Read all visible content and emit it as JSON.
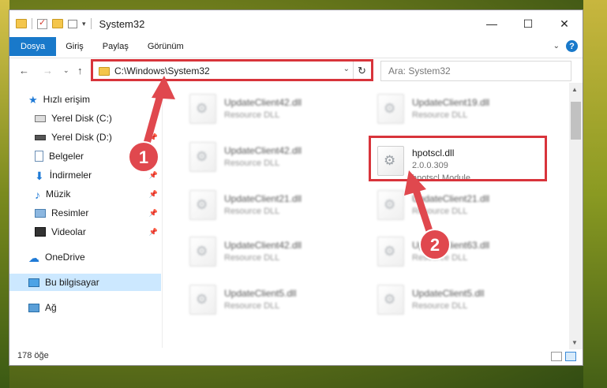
{
  "window": {
    "title": "System32"
  },
  "ribbon": {
    "tabs": [
      "Dosya",
      "Giriş",
      "Paylaş",
      "Görünüm"
    ]
  },
  "address": {
    "path": "C:\\Windows\\System32",
    "search_placeholder": "Ara: System32"
  },
  "sidebar": {
    "items": [
      {
        "label": "Hızlı erişim",
        "pinned": false
      },
      {
        "label": "Yerel Disk (C:)",
        "pinned": true
      },
      {
        "label": "Yerel Disk (D:)",
        "pinned": true
      },
      {
        "label": "Belgeler",
        "pinned": true
      },
      {
        "label": "İndirmeler",
        "pinned": true
      },
      {
        "label": "Müzik",
        "pinned": true
      },
      {
        "label": "Resimler",
        "pinned": true
      },
      {
        "label": "Videolar",
        "pinned": true
      },
      {
        "label": "OneDrive",
        "pinned": false
      },
      {
        "label": "Bu bilgisayar",
        "pinned": false,
        "selected": true
      },
      {
        "label": "Ağ",
        "pinned": false
      }
    ]
  },
  "files": {
    "left": [
      {
        "name": "UpdateClient42.dll",
        "type": "Resource DLL"
      },
      {
        "name": "UpdateClient42.dll",
        "type": "Resource DLL"
      },
      {
        "name": "UpdateClient21.dll",
        "type": "Resource DLL"
      },
      {
        "name": "UpdateClient42.dll",
        "type": "Resource DLL"
      },
      {
        "name": "UpdateClient5.dll",
        "type": "Resource DLL"
      }
    ],
    "right": [
      {
        "name": "UpdateClient19.dll",
        "type": "Resource DLL"
      },
      {
        "name": "hpotscl.dll",
        "version": "2.0.0.309",
        "type": "hpotscl Module"
      },
      {
        "name": "UpdateClient21.dll",
        "type": "Resource DLL"
      },
      {
        "name": "UpdateClient63.dll",
        "type": "Resource DLL"
      },
      {
        "name": "UpdateClient5.dll",
        "type": "Resource DLL"
      }
    ]
  },
  "status": {
    "count": "178 öğe"
  },
  "annotations": {
    "step1": "1",
    "step2": "2",
    "color": "#e0484e"
  }
}
